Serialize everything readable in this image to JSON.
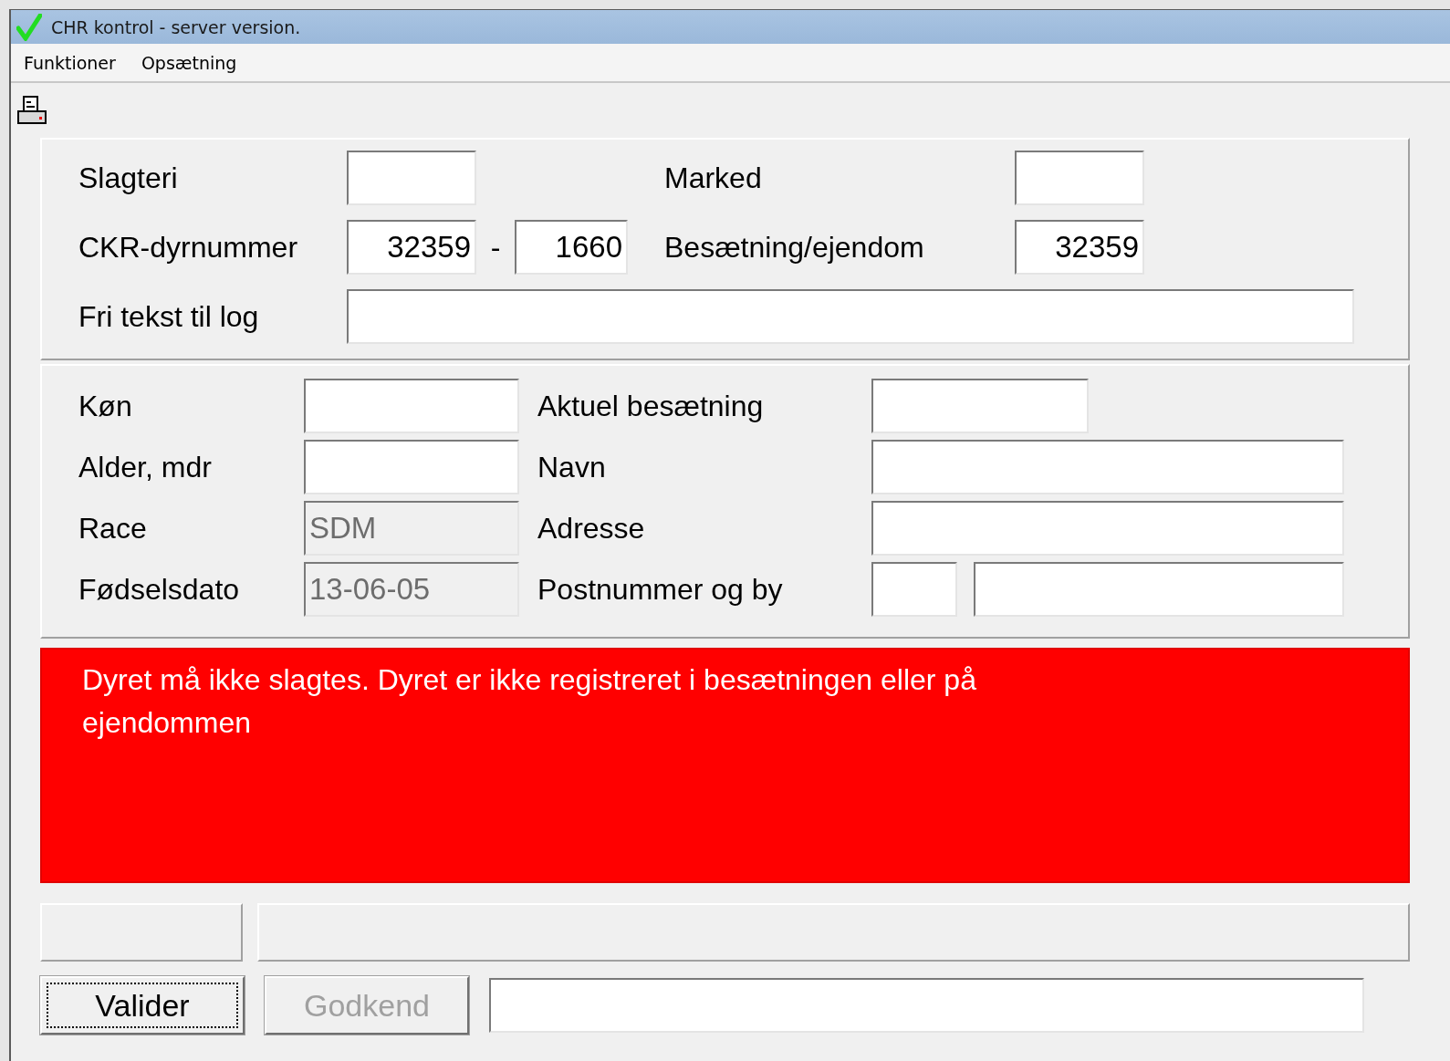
{
  "window": {
    "title": "CHR kontrol - server version."
  },
  "menu": [
    {
      "label": "Funktioner"
    },
    {
      "label": "Opsætning"
    }
  ],
  "header": {
    "slagteri": {
      "label": "Slagteri"
    },
    "marked": {
      "label": "Marked"
    },
    "ckr": {
      "label": "CKR-dyrnummer",
      "value_1": "32359",
      "separator": "-",
      "value_2": "1660"
    },
    "besaetning": {
      "label": "Besætning/ejendom",
      "value": "32359"
    },
    "fritekst": {
      "label": "Fri tekst til log"
    }
  },
  "animal": [
    {
      "label": "Køn",
      "disabled": false
    },
    {
      "label": "Alder, mdr",
      "disabled": false
    },
    {
      "label": "Race",
      "value": "SDM",
      "disabled": true
    },
    {
      "label": "Fødselsdato",
      "value": "13-06-05",
      "disabled": true
    }
  ],
  "owner": [
    {
      "label": "Aktuel besætning",
      "kind": "short"
    },
    {
      "label": "Navn",
      "kind": "wide"
    },
    {
      "label": "Adresse",
      "kind": "wide"
    },
    {
      "label": "Postnummer og by",
      "kind": "split"
    }
  ],
  "message": {
    "text": "Dyret må ikke slagtes. Dyret er ikke registreret i besætningen eller på ejendommen"
  },
  "buttons": [
    {
      "label": "Valider",
      "disabled": false,
      "focused": true
    },
    {
      "label": "Godkend",
      "disabled": true,
      "focused": false
    }
  ]
}
